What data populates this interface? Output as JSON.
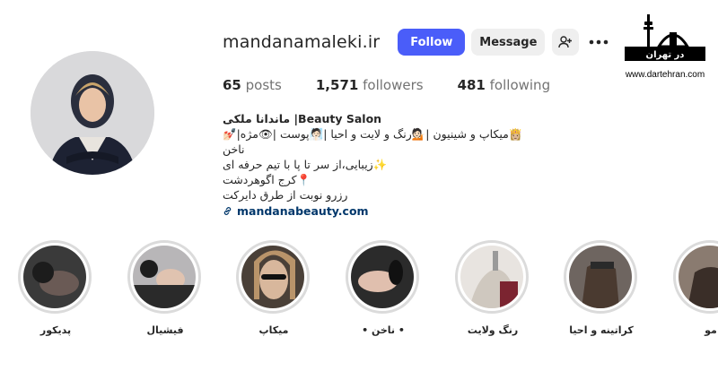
{
  "profile": {
    "username": "mandanamaleki.ir",
    "follow_label": "Follow",
    "message_label": "Message",
    "stats": {
      "posts_count": "65",
      "posts_label": "posts",
      "followers_count": "1,571",
      "followers_label": "followers",
      "following_count": "481",
      "following_label": "following"
    },
    "bio": {
      "name": "ماندانا ملکی |Beauty Salon",
      "line1": "👸🏼میکاپ و شینیون |💁🏻رنگ و لایت و احیا |🧖🏻پوست |👁مژه|💅🏻ناخن",
      "line2": "✨زیبایی،از سر تا پا با تیم حرفه ای",
      "line3": "📍کرج اگوهردشت",
      "line4": "رزرو نوبت از طرق دایرکت",
      "link": "mandanabeauty.com"
    }
  },
  "icons": {
    "add_user": "add-user-icon",
    "more": "more-options-icon",
    "link": "link-icon"
  },
  "highlights": [
    {
      "label": "پدیکور"
    },
    {
      "label": "فیشیال"
    },
    {
      "label": "میکاپ"
    },
    {
      "label": "• ناخن •"
    },
    {
      "label": "رنگ ولایت"
    },
    {
      "label": "کراتینه و احیا"
    },
    {
      "label": "مو"
    }
  ],
  "watermark": {
    "logo_text": "در تهران",
    "url": "www.dartehran.com"
  },
  "colors": {
    "follow_button": "#4a5df9",
    "secondary_button": "#efefef",
    "link": "#00376b",
    "highlight_ring": "#dbdbdb"
  }
}
